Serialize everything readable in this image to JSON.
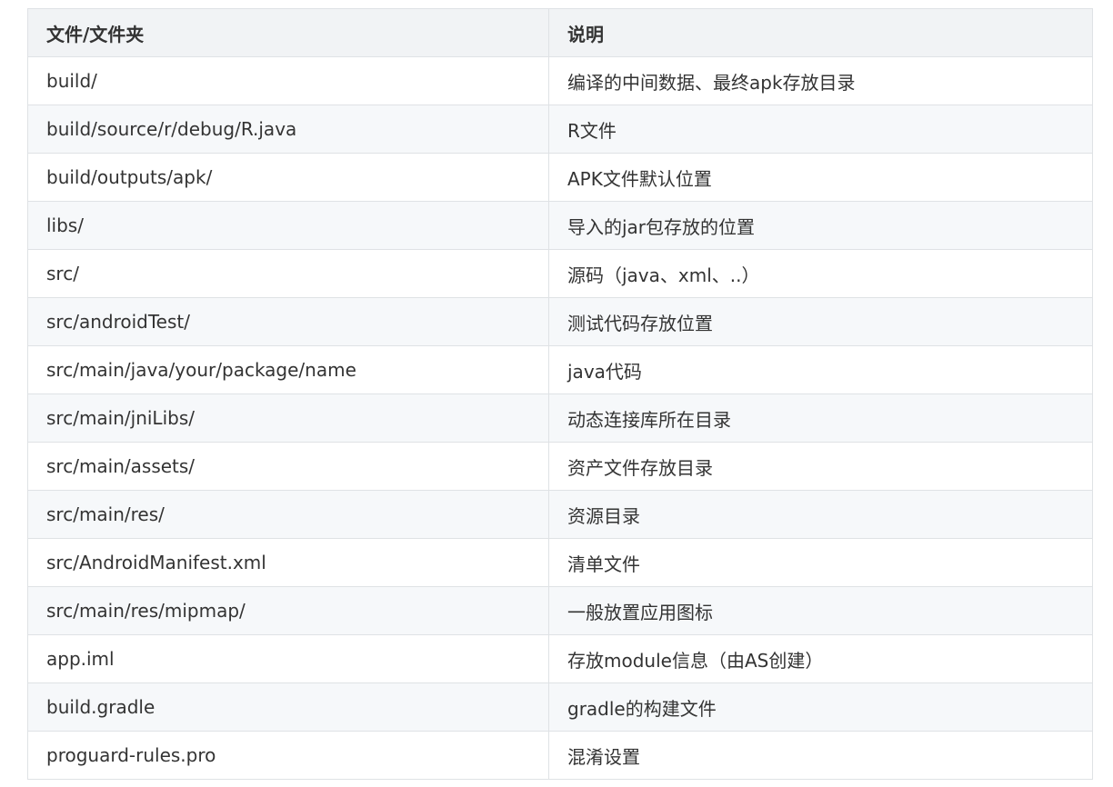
{
  "table": {
    "headers": [
      "文件/文件夹",
      "说明"
    ],
    "rows": [
      [
        "build/",
        "编译的中间数据、最终apk存放目录"
      ],
      [
        "build/source/r/debug/R.java",
        "R文件"
      ],
      [
        "build/outputs/apk/",
        "APK文件默认位置"
      ],
      [
        "libs/",
        "导入的jar包存放的位置"
      ],
      [
        "src/",
        "源码（java、xml、..）"
      ],
      [
        "src/androidTest/",
        "测试代码存放位置"
      ],
      [
        "src/main/java/your/package/name",
        "java代码"
      ],
      [
        "src/main/jniLibs/",
        "动态连接库所在目录"
      ],
      [
        "src/main/assets/",
        "资产文件存放目录"
      ],
      [
        "src/main/res/",
        "资源目录"
      ],
      [
        "src/AndroidManifest.xml",
        "清单文件"
      ],
      [
        "src/main/res/mipmap/",
        "一般放置应用图标"
      ],
      [
        "app.iml",
        "存放module信息（由AS创建）"
      ],
      [
        "build.gradle",
        "gradle的构建文件"
      ],
      [
        "proguard-rules.pro",
        "混淆设置"
      ]
    ]
  },
  "colors": {
    "border": "#dfe2e5",
    "header_bg": "#f1f3f5",
    "stripe_bg": "#f6f8fa",
    "text": "#333333"
  }
}
